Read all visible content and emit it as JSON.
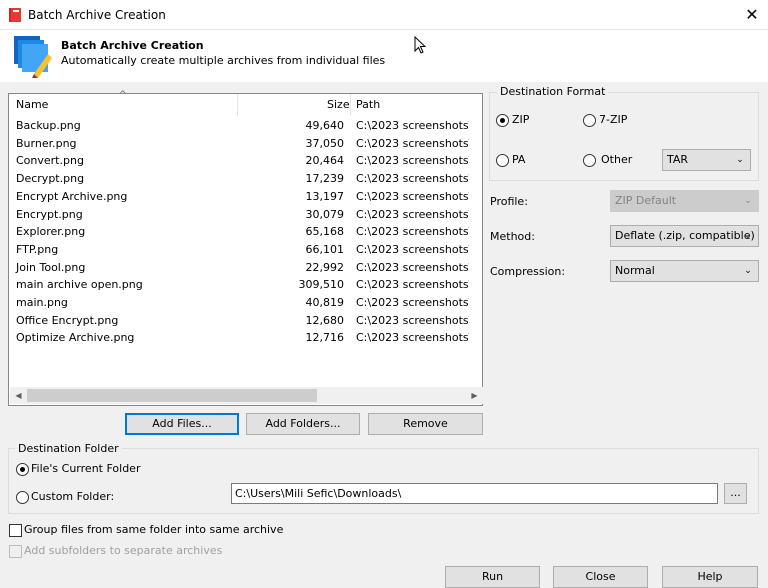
{
  "window": {
    "title": "Batch Archive Creation",
    "close_glyph": "✕",
    "app_icon": "archive-app-icon"
  },
  "header": {
    "title": "Batch Archive Creation",
    "subtitle": "Automatically create multiple archives from individual files",
    "icon": "batch-archive-icon"
  },
  "file_list": {
    "columns": {
      "name": "Name",
      "size": "Size",
      "path": "Path"
    },
    "rows": [
      {
        "name": "Backup.png",
        "size": "49,640",
        "path": "C:\\2023 screenshots\\"
      },
      {
        "name": "Burner.png",
        "size": "37,050",
        "path": "C:\\2023 screenshots\\"
      },
      {
        "name": "Convert.png",
        "size": "20,464",
        "path": "C:\\2023 screenshots\\"
      },
      {
        "name": "Decrypt.png",
        "size": "17,239",
        "path": "C:\\2023 screenshots\\"
      },
      {
        "name": "Encrypt Archive.png",
        "size": "13,197",
        "path": "C:\\2023 screenshots\\"
      },
      {
        "name": "Encrypt.png",
        "size": "30,079",
        "path": "C:\\2023 screenshots\\"
      },
      {
        "name": "Explorer.png",
        "size": "65,168",
        "path": "C:\\2023 screenshots\\"
      },
      {
        "name": "FTP.png",
        "size": "66,101",
        "path": "C:\\2023 screenshots\\"
      },
      {
        "name": "Join Tool.png",
        "size": "22,992",
        "path": "C:\\2023 screenshots\\"
      },
      {
        "name": "main archive open.png",
        "size": "309,510",
        "path": "C:\\2023 screenshots\\"
      },
      {
        "name": "main.png",
        "size": "40,819",
        "path": "C:\\2023 screenshots\\"
      },
      {
        "name": "Office Encrypt.png",
        "size": "12,680",
        "path": "C:\\2023 screenshots\\"
      },
      {
        "name": "Optimize Archive.png",
        "size": "12,716",
        "path": "C:\\2023 screenshots\\"
      }
    ]
  },
  "list_buttons": {
    "add_files": "Add Files...",
    "add_folders": "Add Folders...",
    "remove": "Remove"
  },
  "destination_format": {
    "label": "Destination Format",
    "zip": "ZIP",
    "sevenzip": "7-ZIP",
    "pa": "PA",
    "other": "Other",
    "other_value": "TAR",
    "selected": "ZIP"
  },
  "profile": {
    "label": "Profile:",
    "value": "ZIP Default"
  },
  "method": {
    "label": "Method:",
    "value": "Deflate (.zip, compatible)"
  },
  "compression": {
    "label": "Compression:",
    "value": "Normal"
  },
  "destination_folder": {
    "label": "Destination Folder",
    "current": "File's Current Folder",
    "custom": "Custom Folder:",
    "custom_path": "C:\\Users\\Mili Sefic\\Downloads\\",
    "browse": "..."
  },
  "options": {
    "group_files": "Group files from same folder into same archive",
    "subfolders": "Add subfolders to separate archives"
  },
  "footer": {
    "run": "Run",
    "close": "Close",
    "help": "Help"
  }
}
